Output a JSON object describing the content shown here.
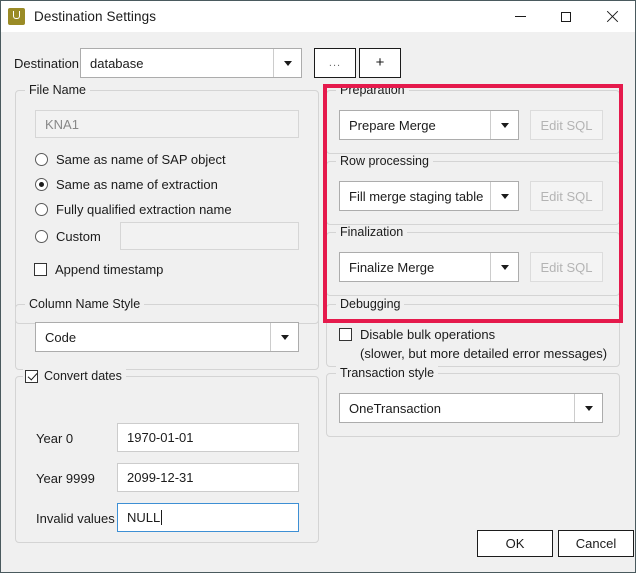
{
  "window": {
    "title": "Destination Settings",
    "icon": "app-u-icon",
    "controls": {
      "minimize": "minimize-icon",
      "maximize": "maximize-icon",
      "close": "close-icon"
    }
  },
  "colors": {
    "highlight": "#e51a4c",
    "dialog_bg": "#f0f0f0",
    "focus_border": "#3d8fd4",
    "app_icon": "#9a8b26"
  },
  "destination": {
    "label": "Destination",
    "value": "database",
    "browse_button": "...",
    "add_button": "+"
  },
  "file_name": {
    "group_title": "File Name",
    "preview_value": "KNA1",
    "options": [
      {
        "label": "Same as name of SAP object",
        "checked": false
      },
      {
        "label": "Same as name of extraction",
        "checked": true
      },
      {
        "label": "Fully qualified extraction name",
        "checked": false
      },
      {
        "label": "Custom",
        "checked": false
      }
    ],
    "custom_value": "",
    "append_timestamp": {
      "label": "Append timestamp",
      "checked": false
    }
  },
  "column_name_style": {
    "group_title": "Column Name Style",
    "value": "Code"
  },
  "convert_dates": {
    "group_title": "Convert dates",
    "checked": true,
    "fields": [
      {
        "label": "Year 0",
        "value": "1970-01-01",
        "focused": false
      },
      {
        "label": "Year 9999",
        "value": "2099-12-31",
        "focused": false
      },
      {
        "label": "Invalid values",
        "value": "NULL",
        "focused": true
      }
    ]
  },
  "preparation": {
    "group_title": "Preparation",
    "value": "Prepare Merge",
    "edit_sql_label": "Edit SQL",
    "edit_sql_enabled": false
  },
  "row_processing": {
    "group_title": "Row processing",
    "value": "Fill merge staging table",
    "edit_sql_label": "Edit SQL",
    "edit_sql_enabled": false
  },
  "finalization": {
    "group_title": "Finalization",
    "value": "Finalize Merge",
    "edit_sql_label": "Edit SQL",
    "edit_sql_enabled": false
  },
  "debugging": {
    "group_title": "Debugging",
    "checkbox_label": "Disable bulk operations",
    "checked": false,
    "hint": "(slower, but more detailed error messages)"
  },
  "transaction_style": {
    "group_title": "Transaction style",
    "value": "OneTransaction"
  },
  "footer": {
    "ok_label": "OK",
    "cancel_label": "Cancel"
  }
}
